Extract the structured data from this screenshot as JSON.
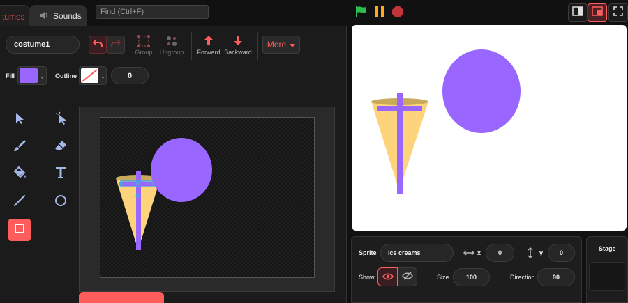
{
  "tabs": {
    "costumes_label": "tumes",
    "sounds_label": "Sounds"
  },
  "find": {
    "placeholder": "Find (Ctrl+F)"
  },
  "costume": {
    "name": "costume1"
  },
  "toolbar": {
    "group_label": "Group",
    "ungroup_label": "Ungroup",
    "forward_label": "Forward",
    "backward_label": "Backward",
    "more_label": "More"
  },
  "fill": {
    "label": "Fill",
    "color": "#9966ff"
  },
  "outline": {
    "label": "Outline",
    "width": "0"
  },
  "sprite": {
    "sprite_label": "Sprite",
    "name": "ice creams",
    "x_label": "x",
    "x": "0",
    "y_label": "y",
    "y": "0",
    "show_label": "Show",
    "size_label": "Size",
    "size": "100",
    "direction_label": "Direction",
    "direction": "90"
  },
  "stage_panel": {
    "title": "Stage"
  },
  "colors": {
    "accent": "#ff5c5c",
    "purple": "#9966ff",
    "cone": "#fdd47c",
    "cone_rim": "#c9a95a",
    "flag": "#2dbd4e",
    "pause": "#ffab19",
    "stop": "#c3343a"
  },
  "icons": [
    "undo-icon",
    "redo-icon",
    "group-icon",
    "ungroup-icon",
    "forward-icon",
    "backward-icon",
    "caret-down-icon",
    "select-icon",
    "reshape-icon",
    "brush-icon",
    "eraser-icon",
    "fill-icon",
    "text-icon",
    "line-icon",
    "circle-icon",
    "rectangle-icon",
    "green-flag-icon",
    "pause-icon",
    "stop-icon",
    "small-stage-icon",
    "large-stage-icon",
    "fullscreen-icon",
    "eye-icon",
    "eye-slash-icon",
    "arrows-horizontal-icon",
    "arrows-vertical-icon",
    "speaker-icon"
  ]
}
